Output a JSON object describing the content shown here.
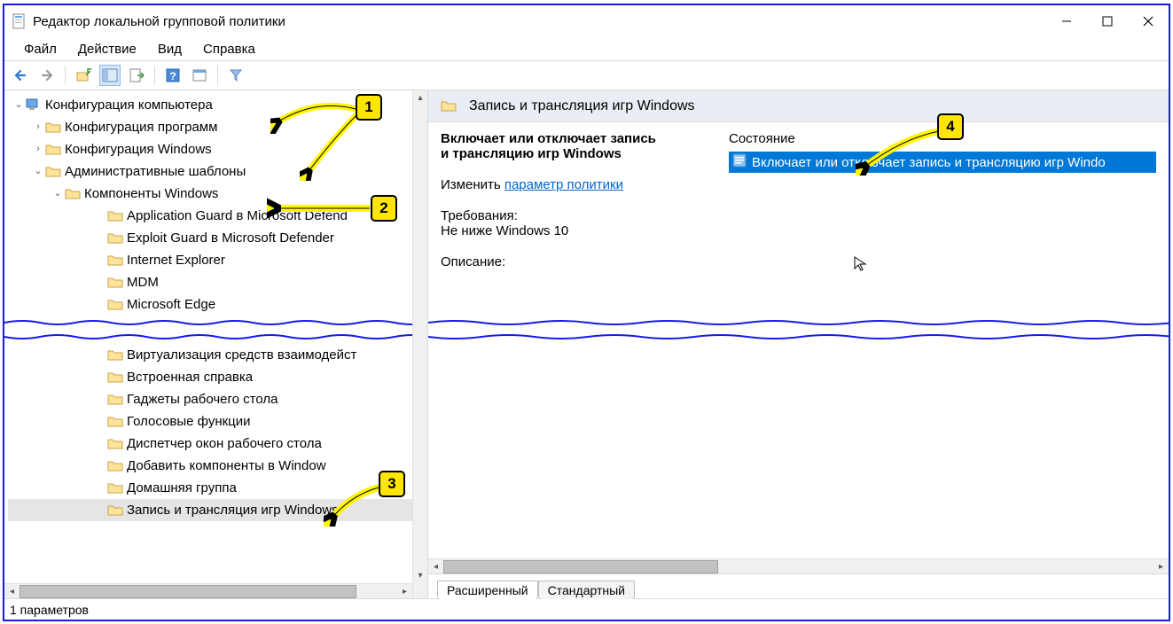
{
  "title": "Редактор локальной групповой политики",
  "menu": {
    "file": "Файл",
    "action": "Действие",
    "view": "Вид",
    "help": "Справка"
  },
  "tree": {
    "root": "Конфигурация компьютера",
    "n1": "Конфигурация программ",
    "n2": "Конфигурация Windows",
    "n3": "Административные шаблоны",
    "n4": "Компоненты Windows",
    "c0": "Application Guard в Microsoft Defend",
    "c1": "Exploit Guard в Microsoft Defender",
    "c2": "Internet Explorer",
    "c3": "MDM",
    "c4": "Microsoft Edge",
    "d0": "Виртуализация средств взаимодейст",
    "d1": "Встроенная справка",
    "d2": "Гаджеты рабочего стола",
    "d3": "Голосовые функции",
    "d4": "Диспетчер окон рабочего стола",
    "d5": "Добавить компоненты в Window",
    "d6": "Домашняя группа",
    "d7": "Запись и трансляция игр Windows"
  },
  "detail": {
    "header": "Запись и трансляция игр Windows",
    "setting_title_l1": "Включает или отключает запись",
    "setting_title_l2": "и трансляцию игр Windows",
    "edit_label": "Изменить",
    "edit_link": "параметр политики",
    "req_label": "Требования:",
    "req_value": "Не ниже Windows 10",
    "desc_label": "Описание:",
    "state_col": "Состояние",
    "policy_item": "Включает или отключает запись и трансляцию игр Windo"
  },
  "tabs": {
    "extended": "Расширенный",
    "standard": "Стандартный"
  },
  "status": "1 параметров",
  "callouts": {
    "c1": "1",
    "c2": "2",
    "c3": "3",
    "c4": "4"
  }
}
